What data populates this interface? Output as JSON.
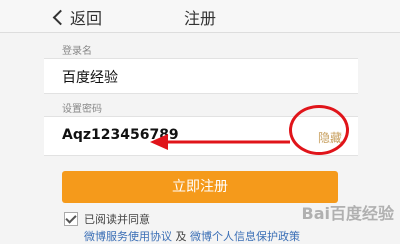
{
  "nav": {
    "back_label": "返回",
    "title": "注册"
  },
  "username": {
    "section_label": "登录名",
    "value": "百度经验"
  },
  "password": {
    "section_label": "设置密码",
    "value": "Aqz123456789",
    "toggle_label": "隐藏"
  },
  "submit_label": "立即注册",
  "agreement": {
    "checked": true,
    "text": "已阅读并同意",
    "link1": "微博服务使用协议",
    "separator": "及",
    "link2": "微博个人信息保护政策"
  },
  "watermark": "Bai百度经验",
  "colors": {
    "accent": "#f59a1b",
    "annotation": "#e0141a",
    "link": "#3b6fb6"
  }
}
